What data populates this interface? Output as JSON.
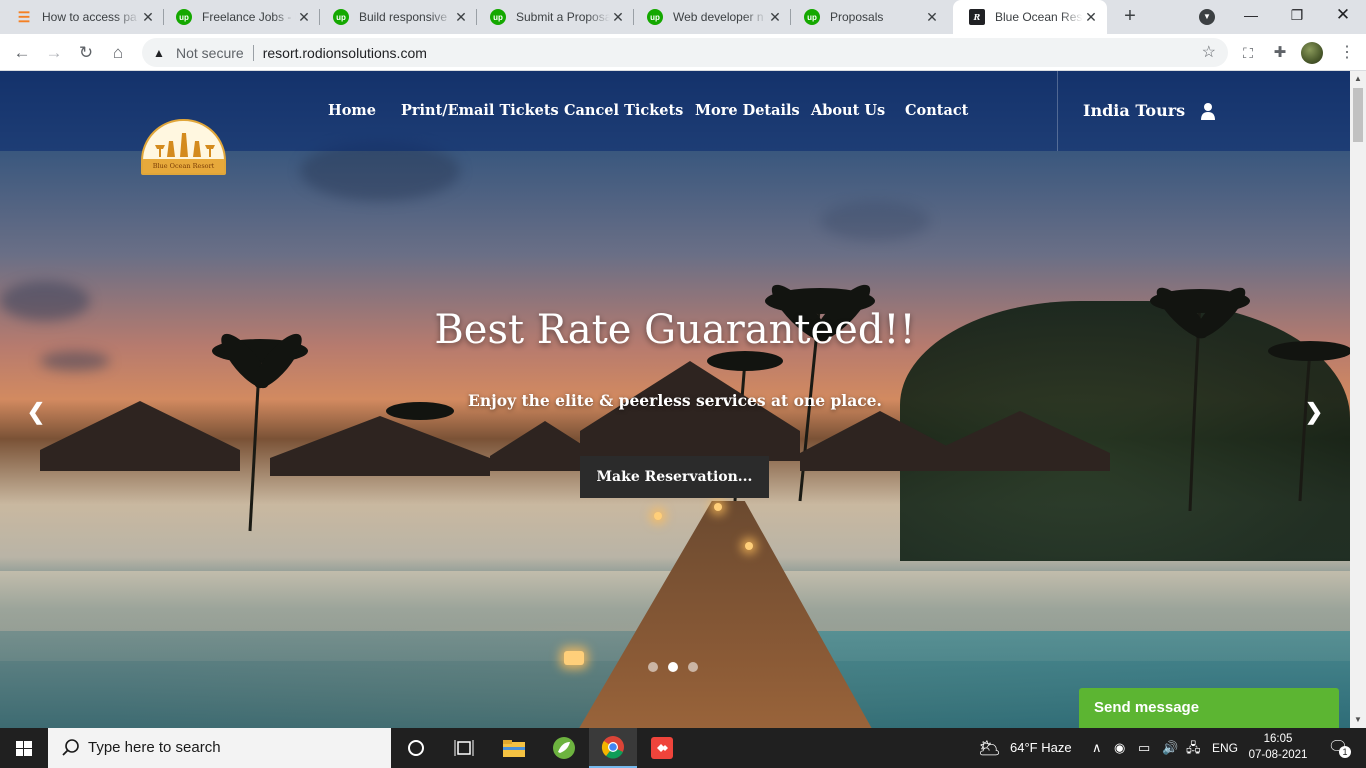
{
  "browser": {
    "tabs": [
      {
        "title": "How to access pa",
        "favicon": "stackoverflow-icon"
      },
      {
        "title": "Freelance Jobs - U",
        "favicon": "upwork-icon"
      },
      {
        "title": "Build responsive",
        "favicon": "upwork-icon"
      },
      {
        "title": "Submit a Proposa",
        "favicon": "upwork-icon"
      },
      {
        "title": "Web developer n",
        "favicon": "upwork-icon"
      },
      {
        "title": "Proposals",
        "favicon": "upwork-icon"
      },
      {
        "title": "Blue Ocean Reso",
        "favicon": "rodion-icon",
        "active": true
      }
    ],
    "security_label": "Not secure",
    "url": "resort.rodionsolutions.com"
  },
  "site": {
    "logo_text": "Blue Ocean Resort",
    "nav": [
      "Home",
      "Print/Email Tickets",
      "Cancel Tickets",
      "More Details",
      "About Us",
      "Contact"
    ],
    "india_tours": "India Tours",
    "hero": {
      "title": "Best Rate Guaranteed!!",
      "subtitle": "Enjoy the elite & peerless services at one place.",
      "cta": "Make Reservation...",
      "slides": 3,
      "active_slide": 2
    },
    "chat_widget": "Send message"
  },
  "taskbar": {
    "search_placeholder": "Type here to search",
    "weather": "64°F  Haze",
    "language": "ENG",
    "time": "16:05",
    "date": "07-08-2021",
    "notification_count": "1"
  },
  "colors": {
    "nav_bg": "#082870",
    "cta_bg": "#2b2b2b",
    "chat_bg": "#5cb532",
    "logo_gold": "#e7a93b"
  }
}
